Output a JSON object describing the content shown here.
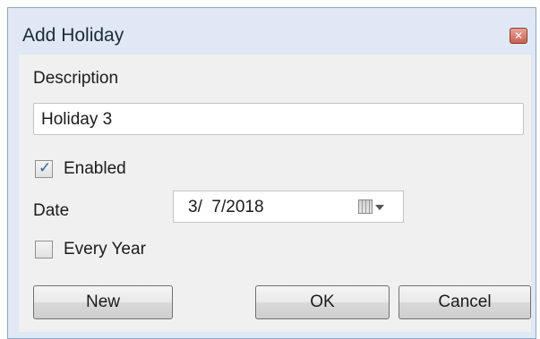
{
  "dialog": {
    "title": "Add Holiday",
    "close_glyph": "✕"
  },
  "description": {
    "label": "Description",
    "value": "Holiday 3"
  },
  "enabled": {
    "label": "Enabled",
    "checked": true,
    "check_glyph": "✓"
  },
  "date": {
    "label": "Date",
    "value": "3/  7/2018",
    "icon": "calendar-icon"
  },
  "every_year": {
    "label": "Every Year",
    "checked": false
  },
  "buttons": {
    "new_label": "New",
    "ok_label": "OK",
    "cancel_label": "Cancel"
  },
  "colors": {
    "frame": "#dfe8f4",
    "client": "#f0f0f0",
    "close_button": "#c9604f",
    "checkmark": "#3a5d9c"
  }
}
